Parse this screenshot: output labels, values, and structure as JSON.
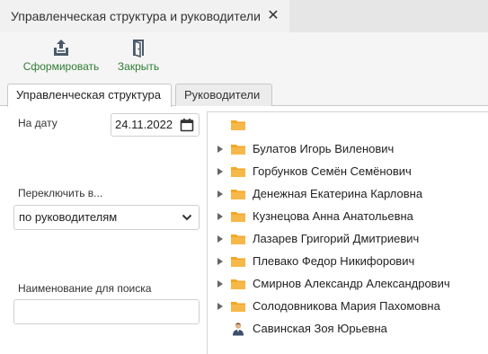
{
  "window": {
    "tab_title": "Управленческая структура и руководители",
    "close_icon": "close-icon"
  },
  "toolbar": {
    "form_label": "Сформировать",
    "form_icon": "export-tray-icon",
    "close_label": "Закрыть",
    "close_icon": "door-exit-icon",
    "label_color": "#2e7d32"
  },
  "tabs": [
    {
      "label": "Управленческая структура",
      "active": true
    },
    {
      "label": "Руководители",
      "active": false
    }
  ],
  "filters": {
    "date_label": "На дату",
    "date_value": "24.11.2022",
    "switch_label": "Переключить в...",
    "switch_value": "по руководителям",
    "search_label": "Наименование для поиска",
    "search_value": ""
  },
  "tree": {
    "folder_color": "#f5a623",
    "nodes": [
      {
        "label": "",
        "icon": "folder-icon",
        "expandable": false
      },
      {
        "label": "Булатов Игорь Виленович",
        "icon": "folder-icon",
        "expandable": true
      },
      {
        "label": "Горбунков Семён Семёнович",
        "icon": "folder-icon",
        "expandable": true
      },
      {
        "label": "Денежная Екатерина Карловна",
        "icon": "folder-icon",
        "expandable": true
      },
      {
        "label": "Кузнецова Анна Анатольевна",
        "icon": "folder-icon",
        "expandable": true
      },
      {
        "label": "Лазарев Григорий Дмитриевич",
        "icon": "folder-icon",
        "expandable": true
      },
      {
        "label": "Плевако Федор Никифорович",
        "icon": "folder-icon",
        "expandable": true
      },
      {
        "label": "Смирнов Александр Александрович",
        "icon": "folder-icon",
        "expandable": true
      },
      {
        "label": "Солодовникова Мария Пахомовна",
        "icon": "folder-icon",
        "expandable": true
      },
      {
        "label": "Савинская Зоя Юрьевна",
        "icon": "person-icon",
        "expandable": false
      }
    ]
  }
}
